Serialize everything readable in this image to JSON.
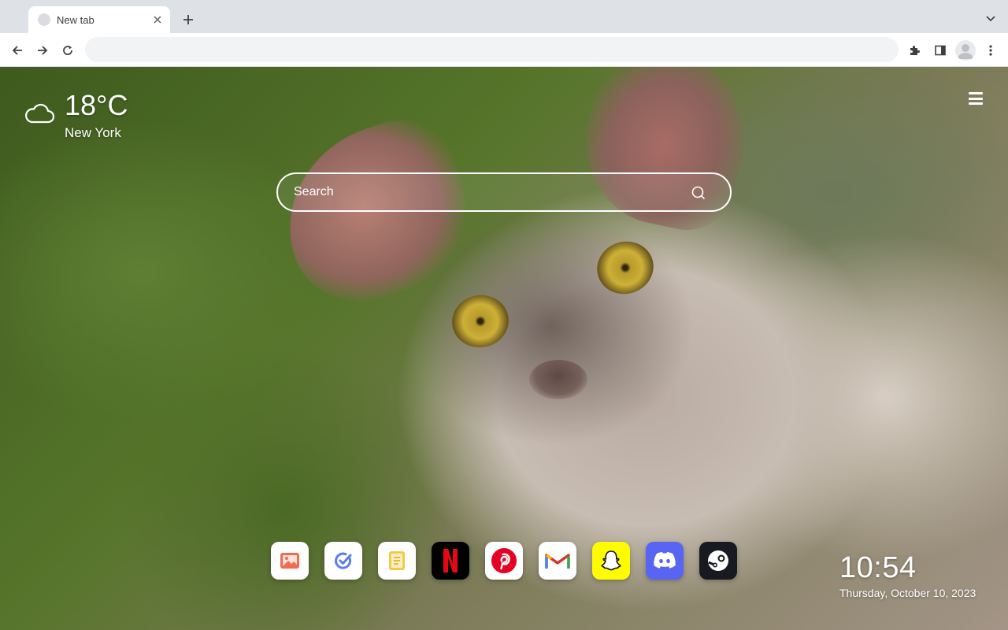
{
  "browser": {
    "tab": {
      "title": "New tab"
    },
    "address_bar": {
      "value": "",
      "placeholder": ""
    }
  },
  "weather": {
    "temperature": "18°C",
    "city": "New York",
    "icon": "cloud-icon"
  },
  "search": {
    "placeholder": "Search"
  },
  "dock": {
    "apps": [
      {
        "name": "Photos",
        "icon": "photos-icon",
        "color": "#ffffff"
      },
      {
        "name": "Tasks",
        "icon": "tasks-icon",
        "color": "#ffffff"
      },
      {
        "name": "Notes",
        "icon": "notes-icon",
        "color": "#ffffff"
      },
      {
        "name": "Netflix",
        "icon": "netflix-icon",
        "color": "#000000"
      },
      {
        "name": "Pinterest",
        "icon": "pinterest-icon",
        "color": "#ffffff"
      },
      {
        "name": "Gmail",
        "icon": "gmail-icon",
        "color": "#ffffff"
      },
      {
        "name": "Snapchat",
        "icon": "snapchat-icon",
        "color": "#fffc00"
      },
      {
        "name": "Discord",
        "icon": "discord-icon",
        "color": "#5865f2"
      },
      {
        "name": "Steam",
        "icon": "steam-icon",
        "color": "#171a21"
      }
    ]
  },
  "clock": {
    "time": "10:54",
    "date": "Thursday, October 10, 2023"
  }
}
